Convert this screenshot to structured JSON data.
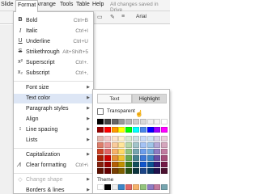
{
  "menubar": {
    "items": [
      "Slide",
      "Format",
      "Arrange",
      "Tools",
      "Table",
      "Help"
    ],
    "status": "All changes saved in Drive"
  },
  "toolbar": {
    "font": "Arial"
  },
  "format_menu": {
    "items": [
      {
        "label": "Bold",
        "shortcut": "Ctrl+B",
        "icon": "bold-icon"
      },
      {
        "label": "Italic",
        "shortcut": "Ctrl+I",
        "icon": "italic-icon"
      },
      {
        "label": "Underline",
        "shortcut": "Ctrl+U",
        "icon": "underline-icon"
      },
      {
        "label": "Strikethrough",
        "shortcut": "Alt+Shift+5",
        "icon": "strikethrough-icon"
      },
      {
        "label": "Superscript",
        "shortcut": "Ctrl+.",
        "icon": "superscript-icon"
      },
      {
        "label": "Subscript",
        "shortcut": "Ctrl+,",
        "icon": "subscript-icon"
      },
      {
        "label": "Font size"
      },
      {
        "label": "Text color"
      },
      {
        "label": "Paragraph styles"
      },
      {
        "label": "Align"
      },
      {
        "label": "Line spacing"
      },
      {
        "label": "Lists"
      },
      {
        "label": "Capitalization"
      },
      {
        "label": "Clear formatting",
        "shortcut": "Ctrl+\\"
      },
      {
        "label": "Change shape"
      },
      {
        "label": "Borders & lines"
      }
    ]
  },
  "color_panel": {
    "tabs": [
      "Text",
      "Highlight"
    ],
    "transparent_label": "Transparent",
    "theme_label": "Theme",
    "grays": [
      "#000000",
      "#434343",
      "#666666",
      "#999999",
      "#b7b7b7",
      "#cccccc",
      "#d9d9d9",
      "#efefef",
      "#f3f3f3",
      "#ffffff"
    ],
    "brights": [
      "#980000",
      "#ff0000",
      "#ff9900",
      "#ffff00",
      "#00ff00",
      "#00ffff",
      "#4a86e8",
      "#0000ff",
      "#9900ff",
      "#ff00ff"
    ],
    "shades": [
      [
        "#e6b8af",
        "#f4cccc",
        "#fce5cd",
        "#fff2cc",
        "#d9ead3",
        "#d0e0e3",
        "#c9daf8",
        "#cfe2f3",
        "#d9d2e9",
        "#ead1dc"
      ],
      [
        "#dd7e6b",
        "#ea9999",
        "#f9cb9c",
        "#ffe599",
        "#b6d7a8",
        "#a2c4c9",
        "#a4c2f4",
        "#9fc5e8",
        "#b4a7d6",
        "#d5a6bd"
      ],
      [
        "#cc4125",
        "#e06666",
        "#f6b26b",
        "#ffd966",
        "#93c47d",
        "#76a5af",
        "#6d9eeb",
        "#6fa8dc",
        "#8e7cc3",
        "#c27ba0"
      ],
      [
        "#a61c00",
        "#cc0000",
        "#e69138",
        "#f1c232",
        "#6aa84f",
        "#45818e",
        "#3c78d8",
        "#3d85c6",
        "#674ea7",
        "#a64d79"
      ],
      [
        "#85200c",
        "#990000",
        "#b45f06",
        "#bf9000",
        "#38761d",
        "#134f5c",
        "#1155cc",
        "#0b5394",
        "#351c75",
        "#741b47"
      ],
      [
        "#5b0f00",
        "#660000",
        "#783f04",
        "#7f6000",
        "#274e13",
        "#0c343d",
        "#1c4587",
        "#073763",
        "#20124d",
        "#4c1130"
      ]
    ],
    "theme": [
      "#ffffff",
      "#000000",
      "#eeeeee",
      "#3d85c6",
      "#e06666",
      "#f6b26b",
      "#93c47d",
      "#8e7cc3",
      "#c27ba0",
      "#76a5af"
    ]
  }
}
